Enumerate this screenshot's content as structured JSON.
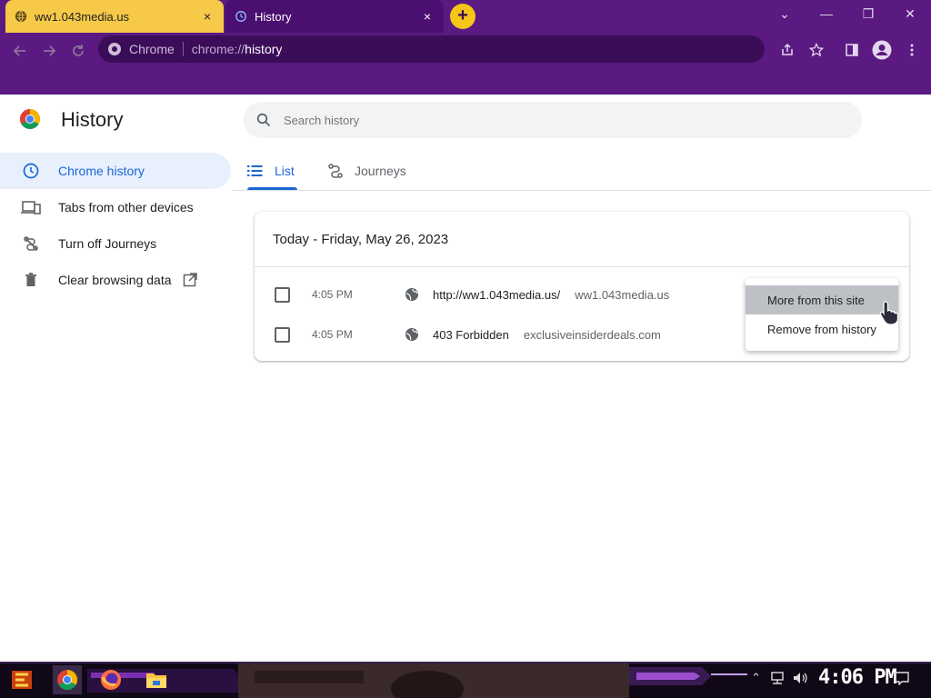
{
  "browser": {
    "tabs": [
      {
        "title": "ww1.043media.us",
        "close": "×"
      },
      {
        "title": "History",
        "close": "×"
      }
    ],
    "new_tab": "+",
    "window_controls": {
      "minimize": "—",
      "maximize": "❐",
      "close": "✕",
      "tab_search": "⌄"
    },
    "omnibox": {
      "site_label": "Chrome",
      "url_prefix": "chrome://",
      "url_host": "history"
    }
  },
  "page": {
    "title": "History",
    "search_placeholder": "Search history"
  },
  "sidebar": {
    "items": [
      {
        "label": "Chrome history",
        "active": true
      },
      {
        "label": "Tabs from other devices"
      },
      {
        "label": "Turn off Journeys"
      },
      {
        "label": "Clear browsing data"
      }
    ]
  },
  "tabs": [
    {
      "label": "List",
      "active": true
    },
    {
      "label": "Journeys"
    }
  ],
  "history": {
    "date_header": "Today - Friday, May 26, 2023",
    "entries": [
      {
        "time": "4:05 PM",
        "title": "http://ww1.043media.us/",
        "domain": "ww1.043media.us"
      },
      {
        "time": "4:05 PM",
        "title": "403 Forbidden",
        "domain": "exclusiveinsiderdeals.com"
      }
    ]
  },
  "context_menu": {
    "items": [
      {
        "label": "More from this site",
        "hovered": true
      },
      {
        "label": "Remove from history"
      }
    ]
  },
  "taskbar": {
    "clock": "4:06 PM"
  },
  "colors": {
    "frame": "#5a1a82",
    "active_tab": "#f7c948",
    "accent": "#1967d2",
    "sidebar_active_bg": "#e8f0fe"
  }
}
